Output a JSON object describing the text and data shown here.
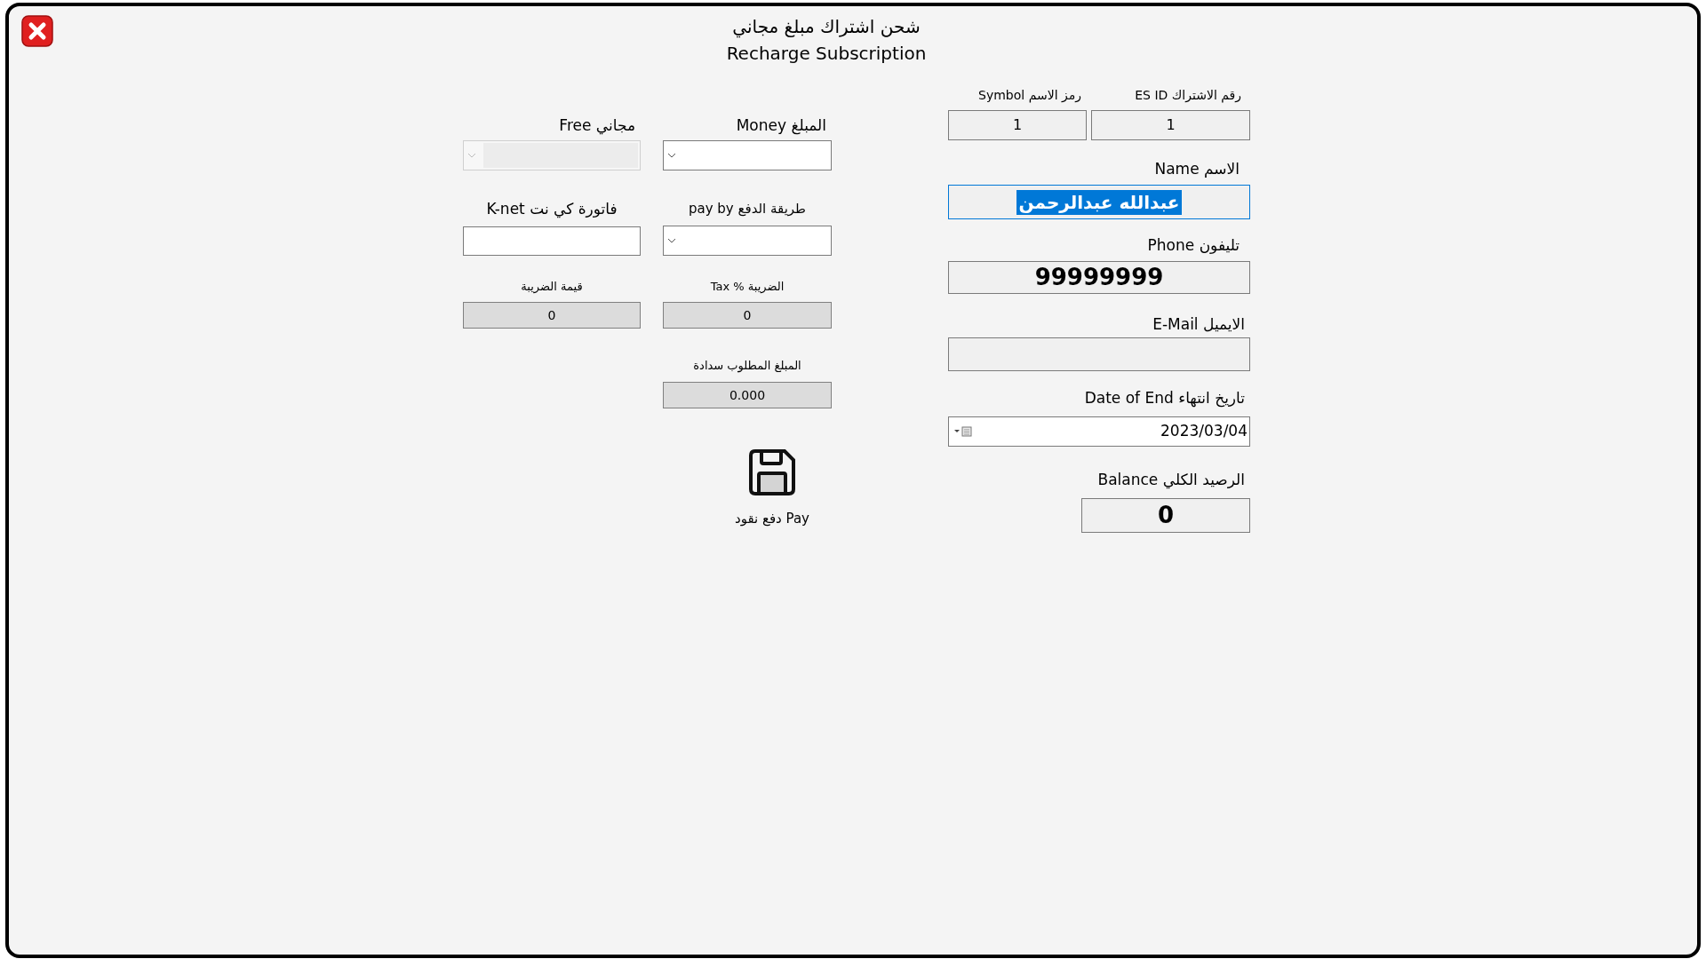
{
  "title": [
    "شحن اشتراك مبلغ مجاني",
    "Recharge Subscription"
  ],
  "right": {
    "id_row": [
      {
        "label": "رقم الاشتراك  ES ID",
        "value": "1"
      },
      {
        "label": "رمز الاسم Symbol",
        "value": "1"
      }
    ],
    "name": {
      "label": "الاسم  Name",
      "value": "عبدالله عبدالرحمن",
      "focused": true
    },
    "phone": {
      "label": "تليفون Phone",
      "value": "99999999"
    },
    "email": {
      "label": "الايميل E-Mail"
    },
    "end_date": {
      "label": "تاريخ انتهاء Date of End",
      "value": "2023/03/04"
    },
    "balance": {
      "label": "الرصيد الكلي Balance",
      "value": "0"
    }
  },
  "middle": {
    "money": {
      "label": "المبلغ Money"
    },
    "pay_by": {
      "label": "طريقة الدفع pay by"
    },
    "tax_percent": {
      "label": "الضريبة % Tax",
      "value": "0"
    },
    "amount_due": {
      "label": "المبلغ المطلوب سدادة",
      "value": "0.000"
    },
    "pay_button": {
      "label": "Pay دفع نقود"
    }
  },
  "left": {
    "free": {
      "label": "مجاني Free",
      "disabled": true
    },
    "knet_invoice": {
      "label": "فاتورة كي نت K-net"
    },
    "tax_value": {
      "label": "قيمة الضريبة",
      "value": "0"
    }
  }
}
